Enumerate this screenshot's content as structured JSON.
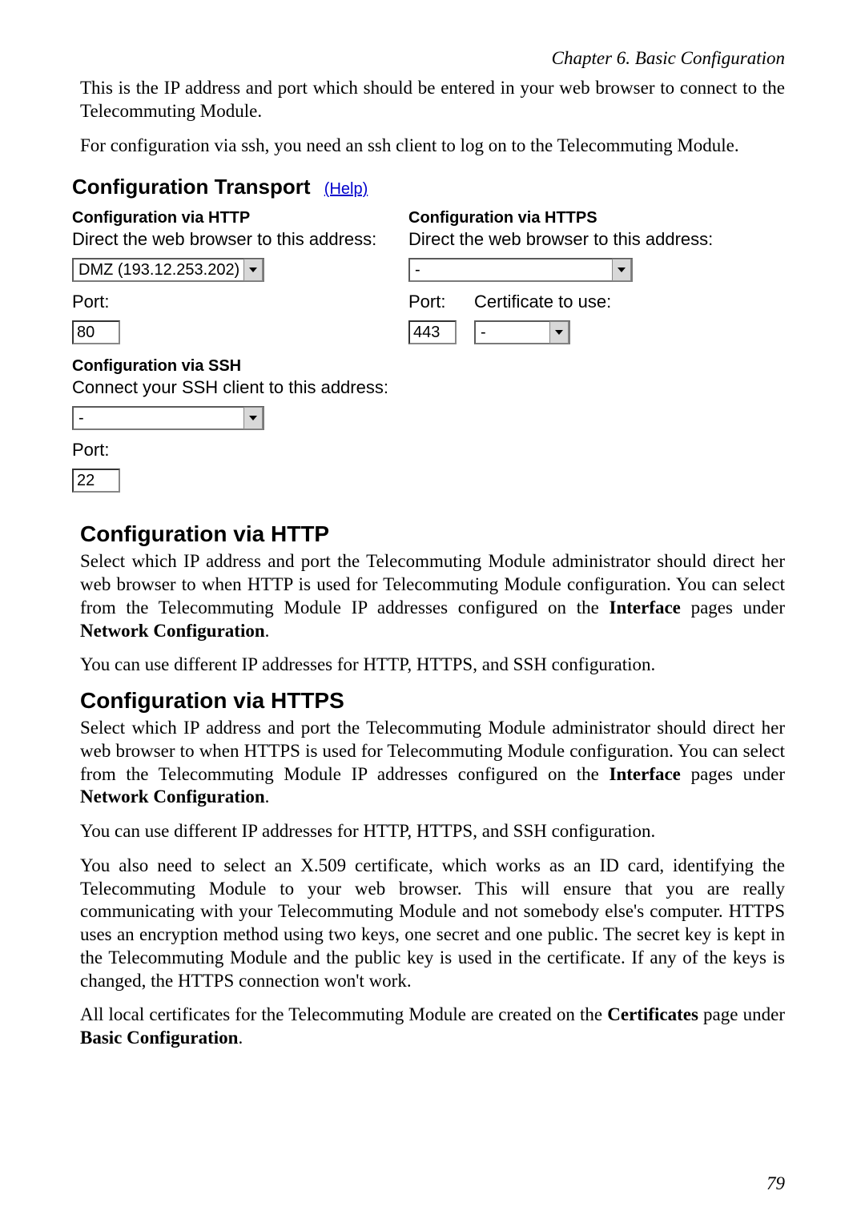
{
  "chapter": "Chapter 6. Basic Configuration",
  "intro1": "This is the IP address and port which should be entered in your web browser to connect to the Telecommuting Module.",
  "intro2": "For configuration via ssh, you need an ssh client to log on to the Telecommuting Module.",
  "ui": {
    "title": "Configuration Transport",
    "help": "(Help)",
    "http": {
      "heading": "Configuration via HTTP",
      "direct": "Direct the web browser to this address:",
      "addr": "DMZ (193.12.253.202)",
      "portLabel": "Port:",
      "port": "80"
    },
    "https": {
      "heading": "Configuration via HTTPS",
      "direct": "Direct the web browser to this address:",
      "addr": "-",
      "portLabel": "Port:",
      "port": "443",
      "certLabel": "Certificate to use:",
      "cert": "-"
    },
    "ssh": {
      "heading": "Configuration via SSH",
      "connect": "Connect your SSH client to this address:",
      "addr": "-",
      "portLabel": "Port:",
      "port": "22"
    }
  },
  "sec_http": {
    "title": "Configuration via HTTP",
    "p1a": "Select which IP address and port the Telecommuting Module administrator should direct her web browser to when HTTP is used for Telecommuting Module configuration. You can select from the Telecommuting Module IP addresses configured on the ",
    "p1b": "Interface",
    "p1c": " pages under ",
    "p1d": "Network Configuration",
    "p1e": ".",
    "p2": "You can use different IP addresses for HTTP, HTTPS, and SSH configuration."
  },
  "sec_https": {
    "title": "Configuration via HTTPS",
    "p1a": "Select which IP address and port the Telecommuting Module administrator should direct her web browser to when HTTPS is used for Telecommuting Module configuration. You can select from the Telecommuting Module IP addresses configured on the ",
    "p1b": "Interface",
    "p1c": " pages under ",
    "p1d": "Network Configuration",
    "p1e": ".",
    "p2": "You can use different IP addresses for HTTP, HTTPS, and SSH configuration.",
    "p3": "You also need to select an X.509 certificate, which works as an ID card, identifying the Telecommuting Module to your web browser. This will ensure that you are really communicating with your Telecommuting Module and not somebody else's computer. HTTPS uses an encryption method using two keys, one secret and one public. The secret key is kept in the Telecommuting Module and the public key is used in the certificate. If any of the keys is changed, the HTTPS connection won't work.",
    "p4a": "All local certificates for the Telecommuting Module are created on the ",
    "p4b": "Certificates",
    "p4c": " page under ",
    "p4d": "Basic Configuration",
    "p4e": "."
  },
  "pageNumber": "79"
}
